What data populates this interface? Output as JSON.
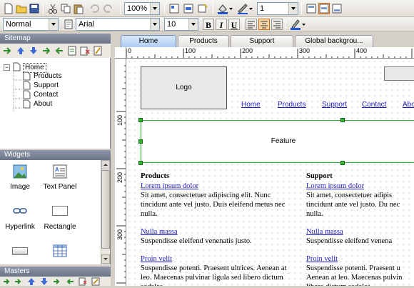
{
  "toolbar1": {
    "zoom": "100%",
    "line_width": "1"
  },
  "toolbar2": {
    "style": "Normal",
    "font": "Arial",
    "size": "10",
    "bold": "B",
    "italic": "I",
    "underline": "U"
  },
  "sitemap": {
    "title": "Sitemap",
    "items": [
      {
        "label": "Home"
      },
      {
        "label": "Products"
      },
      {
        "label": "Support"
      },
      {
        "label": "Contact"
      },
      {
        "label": "About"
      }
    ]
  },
  "widgets": {
    "title": "Widgets",
    "items": [
      {
        "label": "Image",
        "icon": "image-icon"
      },
      {
        "label": "Text Panel",
        "icon": "text-panel-icon"
      },
      {
        "label": "Hyperlink",
        "icon": "hyperlink-icon"
      },
      {
        "label": "Rectangle",
        "icon": "rectangle-icon"
      },
      {
        "label": "",
        "icon": "button-shape-icon"
      },
      {
        "label": "",
        "icon": "table-icon"
      }
    ]
  },
  "masters": {
    "title": "Masters"
  },
  "tabs": [
    {
      "label": "Home"
    },
    {
      "label": "Products"
    },
    {
      "label": "Support"
    },
    {
      "label": "Global backgrou..."
    }
  ],
  "ruler": {
    "h": [
      "0",
      "100",
      "200",
      "300",
      "400"
    ],
    "v": [
      "100",
      "200",
      "300"
    ]
  },
  "canvas": {
    "logo": "Logo",
    "nav": [
      "Home",
      "Products",
      "Support",
      "Contact",
      "Abo"
    ],
    "feature": "Feature",
    "col1": {
      "heading": "Products",
      "link1": "Lorem ipsum dolor",
      "p1": "Sit amet, consectetuer adipiscing elit. Nunc tincidunt ante vel justo. Duis eleifend metus nec nulla.",
      "link2": "Nulla massa",
      "p2": "Suspendisse eleifend venenatis justo.",
      "link3": "Proin velit",
      "p3": "Suspendisse potenti. Praesent ultrices. Aenean at leo. Maecenas pulvinar ligula sed libero dictum sodales."
    },
    "col2": {
      "heading": "Support",
      "link1": "Lorem ipsum dolor",
      "p1": "Sit amet, consectetuer adipis tincidunt ante vel justo. Du nec nulla.",
      "link2": "Nulla massa",
      "p2": "Suspendisse eleifend venena",
      "link3": "Proin velit",
      "p3": "Suspendisse potenti. Praesent u Aenean at leo. Maecenas pulvin libero dictum sodales."
    }
  }
}
